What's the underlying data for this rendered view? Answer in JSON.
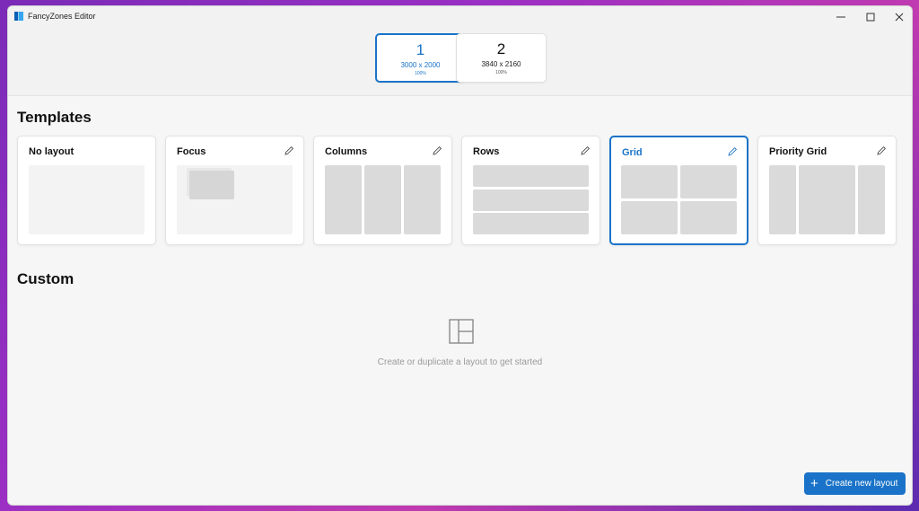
{
  "window": {
    "title": "FancyZones Editor"
  },
  "monitors": [
    {
      "number": "1",
      "resolution": "3000 x 2000",
      "scale": "100%",
      "selected": true
    },
    {
      "number": "2",
      "resolution": "3840 x 2160",
      "scale": "100%",
      "selected": false
    }
  ],
  "templates": {
    "heading": "Templates",
    "cards": [
      {
        "label": "No layout",
        "editable": false,
        "selected": false
      },
      {
        "label": "Focus",
        "editable": true,
        "selected": false
      },
      {
        "label": "Columns",
        "editable": true,
        "selected": false
      },
      {
        "label": "Rows",
        "editable": true,
        "selected": false
      },
      {
        "label": "Grid",
        "editable": true,
        "selected": true
      },
      {
        "label": "Priority Grid",
        "editable": true,
        "selected": false
      }
    ]
  },
  "custom": {
    "heading": "Custom",
    "empty_message": "Create or duplicate a layout to get started"
  },
  "actions": {
    "create_label": "Create new layout"
  },
  "colors": {
    "accent": "#1a73c8",
    "zone": "#dadada"
  },
  "icons": {
    "app": "fancyzones-icon",
    "edit": "pencil-icon",
    "empty": "layout-icon",
    "create": "plus-icon"
  }
}
